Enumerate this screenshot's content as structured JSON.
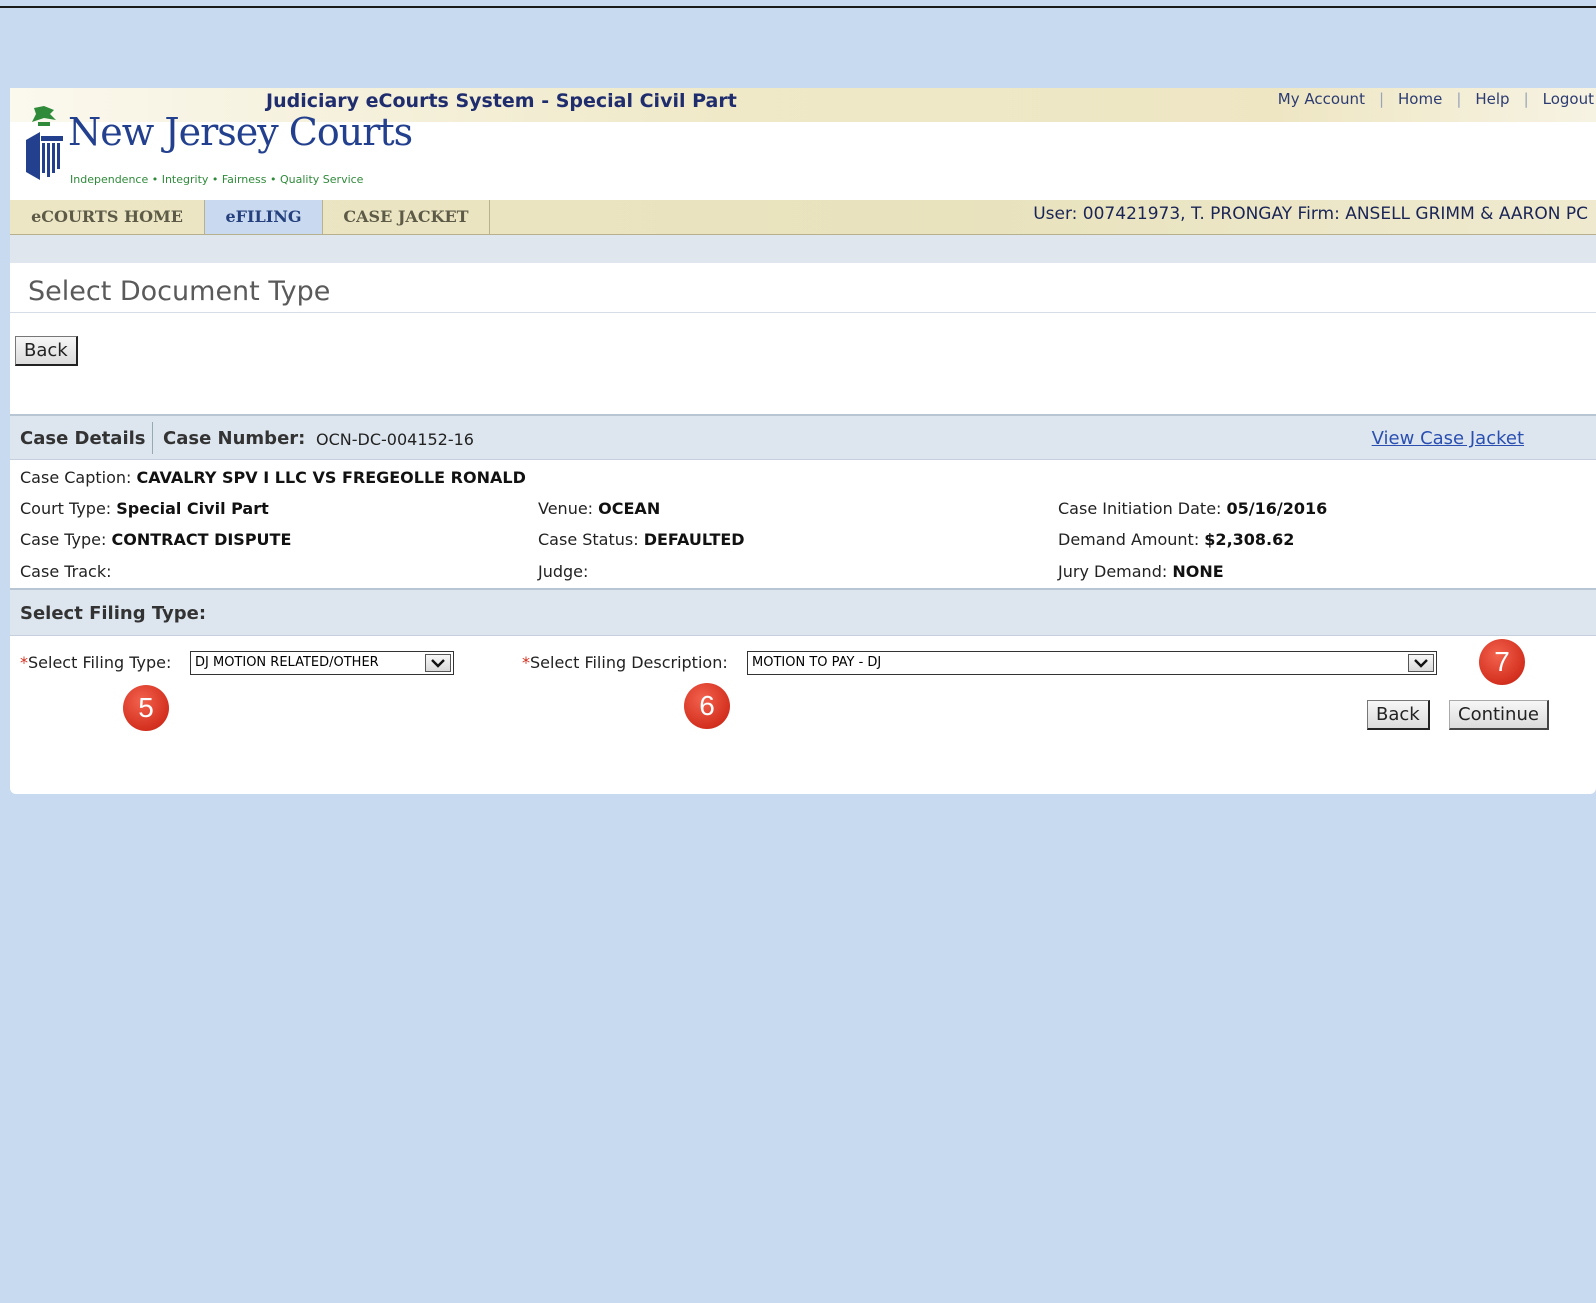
{
  "header": {
    "system_title": "Judiciary eCourts System - Special Civil Part",
    "links": [
      "My Account",
      "Home",
      "Help",
      "Logout"
    ],
    "logo_title": "New Jersey Courts",
    "logo_tagline": "Independence • Integrity • Fairness • Quality Service"
  },
  "nav": {
    "tabs": [
      "eCOURTS HOME",
      "eFILING",
      "CASE JACKET"
    ],
    "active_tab": "eFILING",
    "user_info": "User: 007421973, T. PRONGAY  Firm: ANSELL GRIMM & AARON PC"
  },
  "page_title": "Select Document Type",
  "back_label": "Back",
  "case": {
    "section_label": "Case Details",
    "number_label": "Case Number:",
    "number": "OCN-DC-004152-16",
    "view_jacket": "View Case Jacket",
    "caption_label": "Case Caption:",
    "caption": "CAVALRY SPV I LLC VS FREGEOLLE RONALD",
    "court_type_label": "Court Type:",
    "court_type": "Special Civil Part",
    "venue_label": "Venue:",
    "venue": "OCEAN",
    "init_date_label": "Case Initiation Date:",
    "init_date": "05/16/2016",
    "case_type_label": "Case Type:",
    "case_type": "CONTRACT DISPUTE",
    "status_label": "Case Status:",
    "status": "DEFAULTED",
    "demand_label": "Demand Amount:",
    "demand": "$2,308.62",
    "track_label": "Case Track:",
    "judge_label": "Judge:",
    "jury_label": "Jury Demand:",
    "jury": "NONE"
  },
  "filing": {
    "section_label": "Select Filing Type:",
    "type_label": "Select Filing Type:",
    "type_value": "DJ MOTION RELATED/OTHER",
    "desc_label": "Select Filing Description:",
    "desc_value": "MOTION TO PAY - DJ",
    "back_label": "Back",
    "continue_label": "Continue",
    "callouts": [
      "5",
      "6",
      "7"
    ]
  },
  "colors": {
    "background": "#c7daf0",
    "title_blue": "#1f2d6e",
    "active_tab": "#c9d9ef",
    "callout_red": "#d4301f"
  }
}
